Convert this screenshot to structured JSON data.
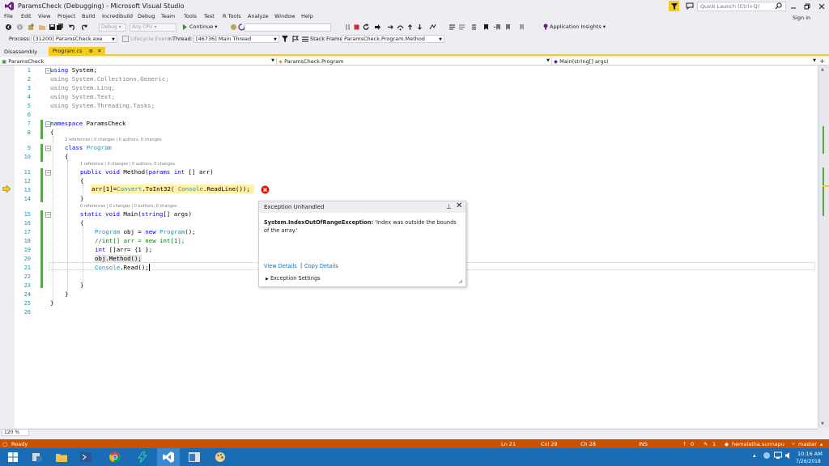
{
  "window": {
    "title": "ParamsCheck (Debugging) - Microsoft Visual Studio",
    "quick_launch_placeholder": "Quick Launch (Ctrl+Q)",
    "signin_label": "Sign in"
  },
  "menu": [
    "File",
    "Edit",
    "View",
    "Project",
    "Build",
    "Incredibuild",
    "Debug",
    "Team",
    "Tools",
    "Test",
    "R Tools",
    "Analyze",
    "Window",
    "Help"
  ],
  "toolbar": {
    "config": "Debug",
    "platform": "Any CPU",
    "continue_label": "Continue",
    "app_insights_label": "Application Insights"
  },
  "debug_location": {
    "process_label": "Process:",
    "process_value": "[31200] ParamsCheck.exe",
    "lifecycle_label": "Lifecycle Events",
    "thread_label": "Thread:",
    "thread_value": "[46736] Main Thread",
    "stackframe_label": "Stack Frame:",
    "stackframe_value": "ParamsCheck.Program.Method"
  },
  "tabs": {
    "disassembly": "Disassembly",
    "program": "Program.cs",
    "program_pin": "⊕",
    "program_close": "✕"
  },
  "nav": {
    "project": "ParamsCheck",
    "type": "ParamsCheck.Program",
    "member": "Main(string[] args)"
  },
  "editor": {
    "line_numbers": [
      "1",
      "2",
      "3",
      "4",
      "5",
      "6",
      "7",
      "8",
      "9",
      "10",
      "11",
      "12",
      "13",
      "14",
      "15",
      "16",
      "17",
      "18",
      "19",
      "20",
      "21",
      "22",
      "23",
      "24",
      "25",
      "26"
    ],
    "lens_program": "2 references | 0 changes | 0 authors, 0 changes",
    "lens_method": "1 reference | 0 changes | 0 authors, 0 changes",
    "lens_main": "0 references | 0 changes | 0 authors, 0 changes"
  },
  "exception": {
    "title": "Exception Unhandled",
    "type": "System.IndexOutOfRangeException:",
    "message": " 'Index was outside the bounds of the array.'",
    "view_details": "View Details",
    "separator": "|",
    "copy_details": "Copy Details",
    "settings": "Exception Settings"
  },
  "zoom": "120 %",
  "status": {
    "ready": "Ready",
    "ln": "Ln 21",
    "col": "Col 28",
    "ch": "Ch 28",
    "ins": "INS",
    "up_count": "0",
    "edit_count": "1",
    "user": "hemalatha.sunnapu",
    "branch": "master"
  },
  "taskbar": {
    "time": "10:16 AM",
    "date": "7/26/2018"
  },
  "colors": {
    "status_bar": "#ca5100",
    "accent_tab": "#f5cc1b",
    "taskbar": "#1a6db5"
  }
}
